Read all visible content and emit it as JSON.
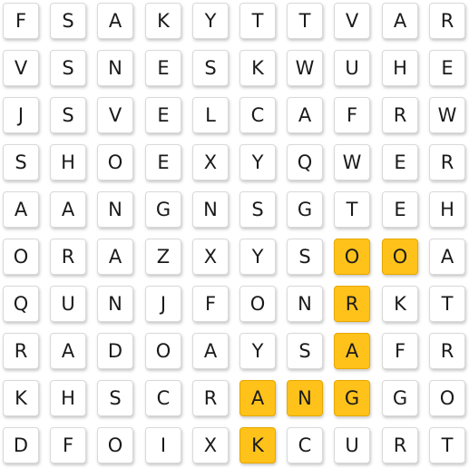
{
  "grid": [
    [
      "F",
      "S",
      "A",
      "K",
      "Y",
      "T",
      "T",
      "V",
      "A",
      "R"
    ],
    [
      "V",
      "S",
      "N",
      "E",
      "S",
      "K",
      "W",
      "U",
      "H",
      "E"
    ],
    [
      "J",
      "S",
      "V",
      "E",
      "L",
      "C",
      "A",
      "F",
      "R",
      "W"
    ],
    [
      "S",
      "H",
      "O",
      "E",
      "X",
      "Y",
      "Q",
      "W",
      "E",
      "R"
    ],
    [
      "A",
      "A",
      "N",
      "G",
      "N",
      "S",
      "G",
      "T",
      "E",
      "H"
    ],
    [
      "O",
      "R",
      "A",
      "Z",
      "X",
      "Y",
      "S",
      "O",
      "O",
      "A"
    ],
    [
      "Q",
      "U",
      "N",
      "J",
      "F",
      "O",
      "N",
      "R",
      "K",
      "T"
    ],
    [
      "R",
      "A",
      "D",
      "O",
      "A",
      "Y",
      "S",
      "A",
      "F",
      "R"
    ],
    [
      "K",
      "H",
      "S",
      "C",
      "R",
      "A",
      "N",
      "G",
      "G",
      "O"
    ],
    [
      "D",
      "F",
      "O",
      "I",
      "X",
      "K",
      "C",
      "U",
      "R",
      "T"
    ]
  ],
  "highlighted": [
    [
      5,
      7
    ],
    [
      5,
      8
    ],
    [
      6,
      7
    ],
    [
      7,
      7
    ],
    [
      8,
      5
    ],
    [
      8,
      6
    ],
    [
      8,
      7
    ],
    [
      9,
      5
    ]
  ],
  "colors": {
    "highlight": "#ffc21a",
    "tile": "#ffffff",
    "text": "#1a1a1a"
  }
}
